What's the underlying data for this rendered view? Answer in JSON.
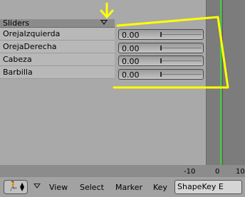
{
  "panel": {
    "header_label": "Sliders",
    "collapse_icon": "triangle-down-icon"
  },
  "shape_keys": [
    {
      "name": "OrejaIzquierda",
      "value": "0.00"
    },
    {
      "name": "OrejaDerecha",
      "value": "0.00"
    },
    {
      "name": "Cabeza",
      "value": "0.00"
    },
    {
      "name": "Barbilla",
      "value": "0.00"
    }
  ],
  "ruler": {
    "ticks": [
      "-10",
      "0",
      "10"
    ]
  },
  "header": {
    "editor_icon": "action-editor-icon",
    "menus": [
      "View",
      "Select",
      "Marker",
      "Key"
    ],
    "mode_select": "ShapeKey E"
  },
  "colors": {
    "annotation": "#ffff00",
    "current_frame": "#3fcf3f"
  }
}
